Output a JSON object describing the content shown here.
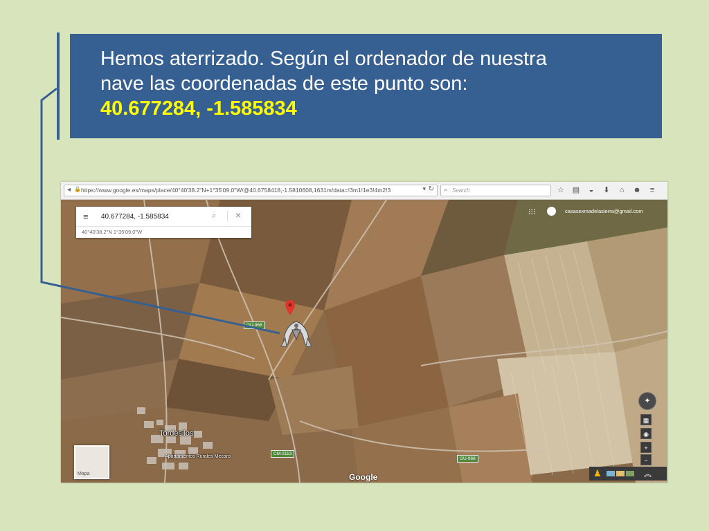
{
  "slide": {
    "title_line1": "Hemos aterrizado. Según el ordenador de nuestra",
    "title_line2": "nave las coordenadas de este punto son:",
    "coords": "40.677284, -1.585834",
    "accent_color": "#376092",
    "highlight_color": "#ffff00"
  },
  "browser": {
    "url": "https://www.google.es/maps/place/40°40'38.2\"N+1°35'09.0\"W/@40.6758418,-1.5810608,1631m/data=!3m1!1e3!4m2!3",
    "search_placeholder": "Search",
    "toolbar_icons": [
      "star-icon",
      "clipboard-icon",
      "pocket-icon",
      "download-icon",
      "home-icon",
      "chat-icon",
      "menu-icon"
    ]
  },
  "maps": {
    "query": "40.677284, -1.585834",
    "sub_coords": "40°40'38.2\"N 1°35'09.0\"W",
    "account": "casasexmadelasierra@gmail.com",
    "town": "Tordesilos",
    "town_sub": "Apartamentos Rurales Mecaro",
    "roads": [
      "GU-968",
      "GU-968",
      "CM-2113"
    ],
    "layer_label": "Mapa",
    "logo": "Google"
  }
}
